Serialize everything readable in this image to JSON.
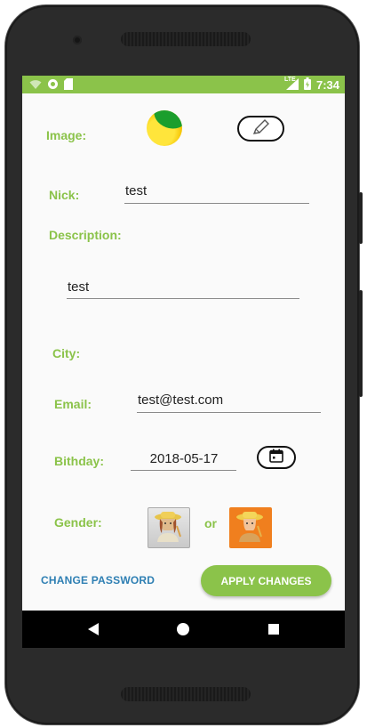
{
  "status_bar": {
    "time": "7:34",
    "network": "LTE",
    "icons": [
      "wifi-icon",
      "circle-notification-icon",
      "sd-card-icon",
      "signal-icon",
      "battery-icon"
    ]
  },
  "form": {
    "image_label": "Image:",
    "nick_label": "Nick:",
    "nick_value": "test",
    "description_label": "Description:",
    "description_value": "test",
    "city_label": "City:",
    "city_value": "",
    "email_label": "Email:",
    "email_value": "test@test.com",
    "birthday_label": "Bithday:",
    "birthday_value": "2018-05-17",
    "gender_label": "Gender:",
    "gender_or": "or",
    "gender_options": [
      "female-farmer",
      "male-farmer"
    ],
    "selected_gender": "male-farmer"
  },
  "actions": {
    "change_password": "CHANGE PASSWORD",
    "apply_changes": "APPLY CHANGES"
  },
  "colors": {
    "accent": "#8bc34a",
    "link": "#2e7fb3",
    "selected_gender_bg": "#f07f1e"
  },
  "icons": {
    "edit_image": "pencil-icon",
    "date_picker": "calendar-icon",
    "nav_back": "back-triangle-icon",
    "nav_home": "home-circle-icon",
    "nav_recents": "recents-square-icon"
  }
}
